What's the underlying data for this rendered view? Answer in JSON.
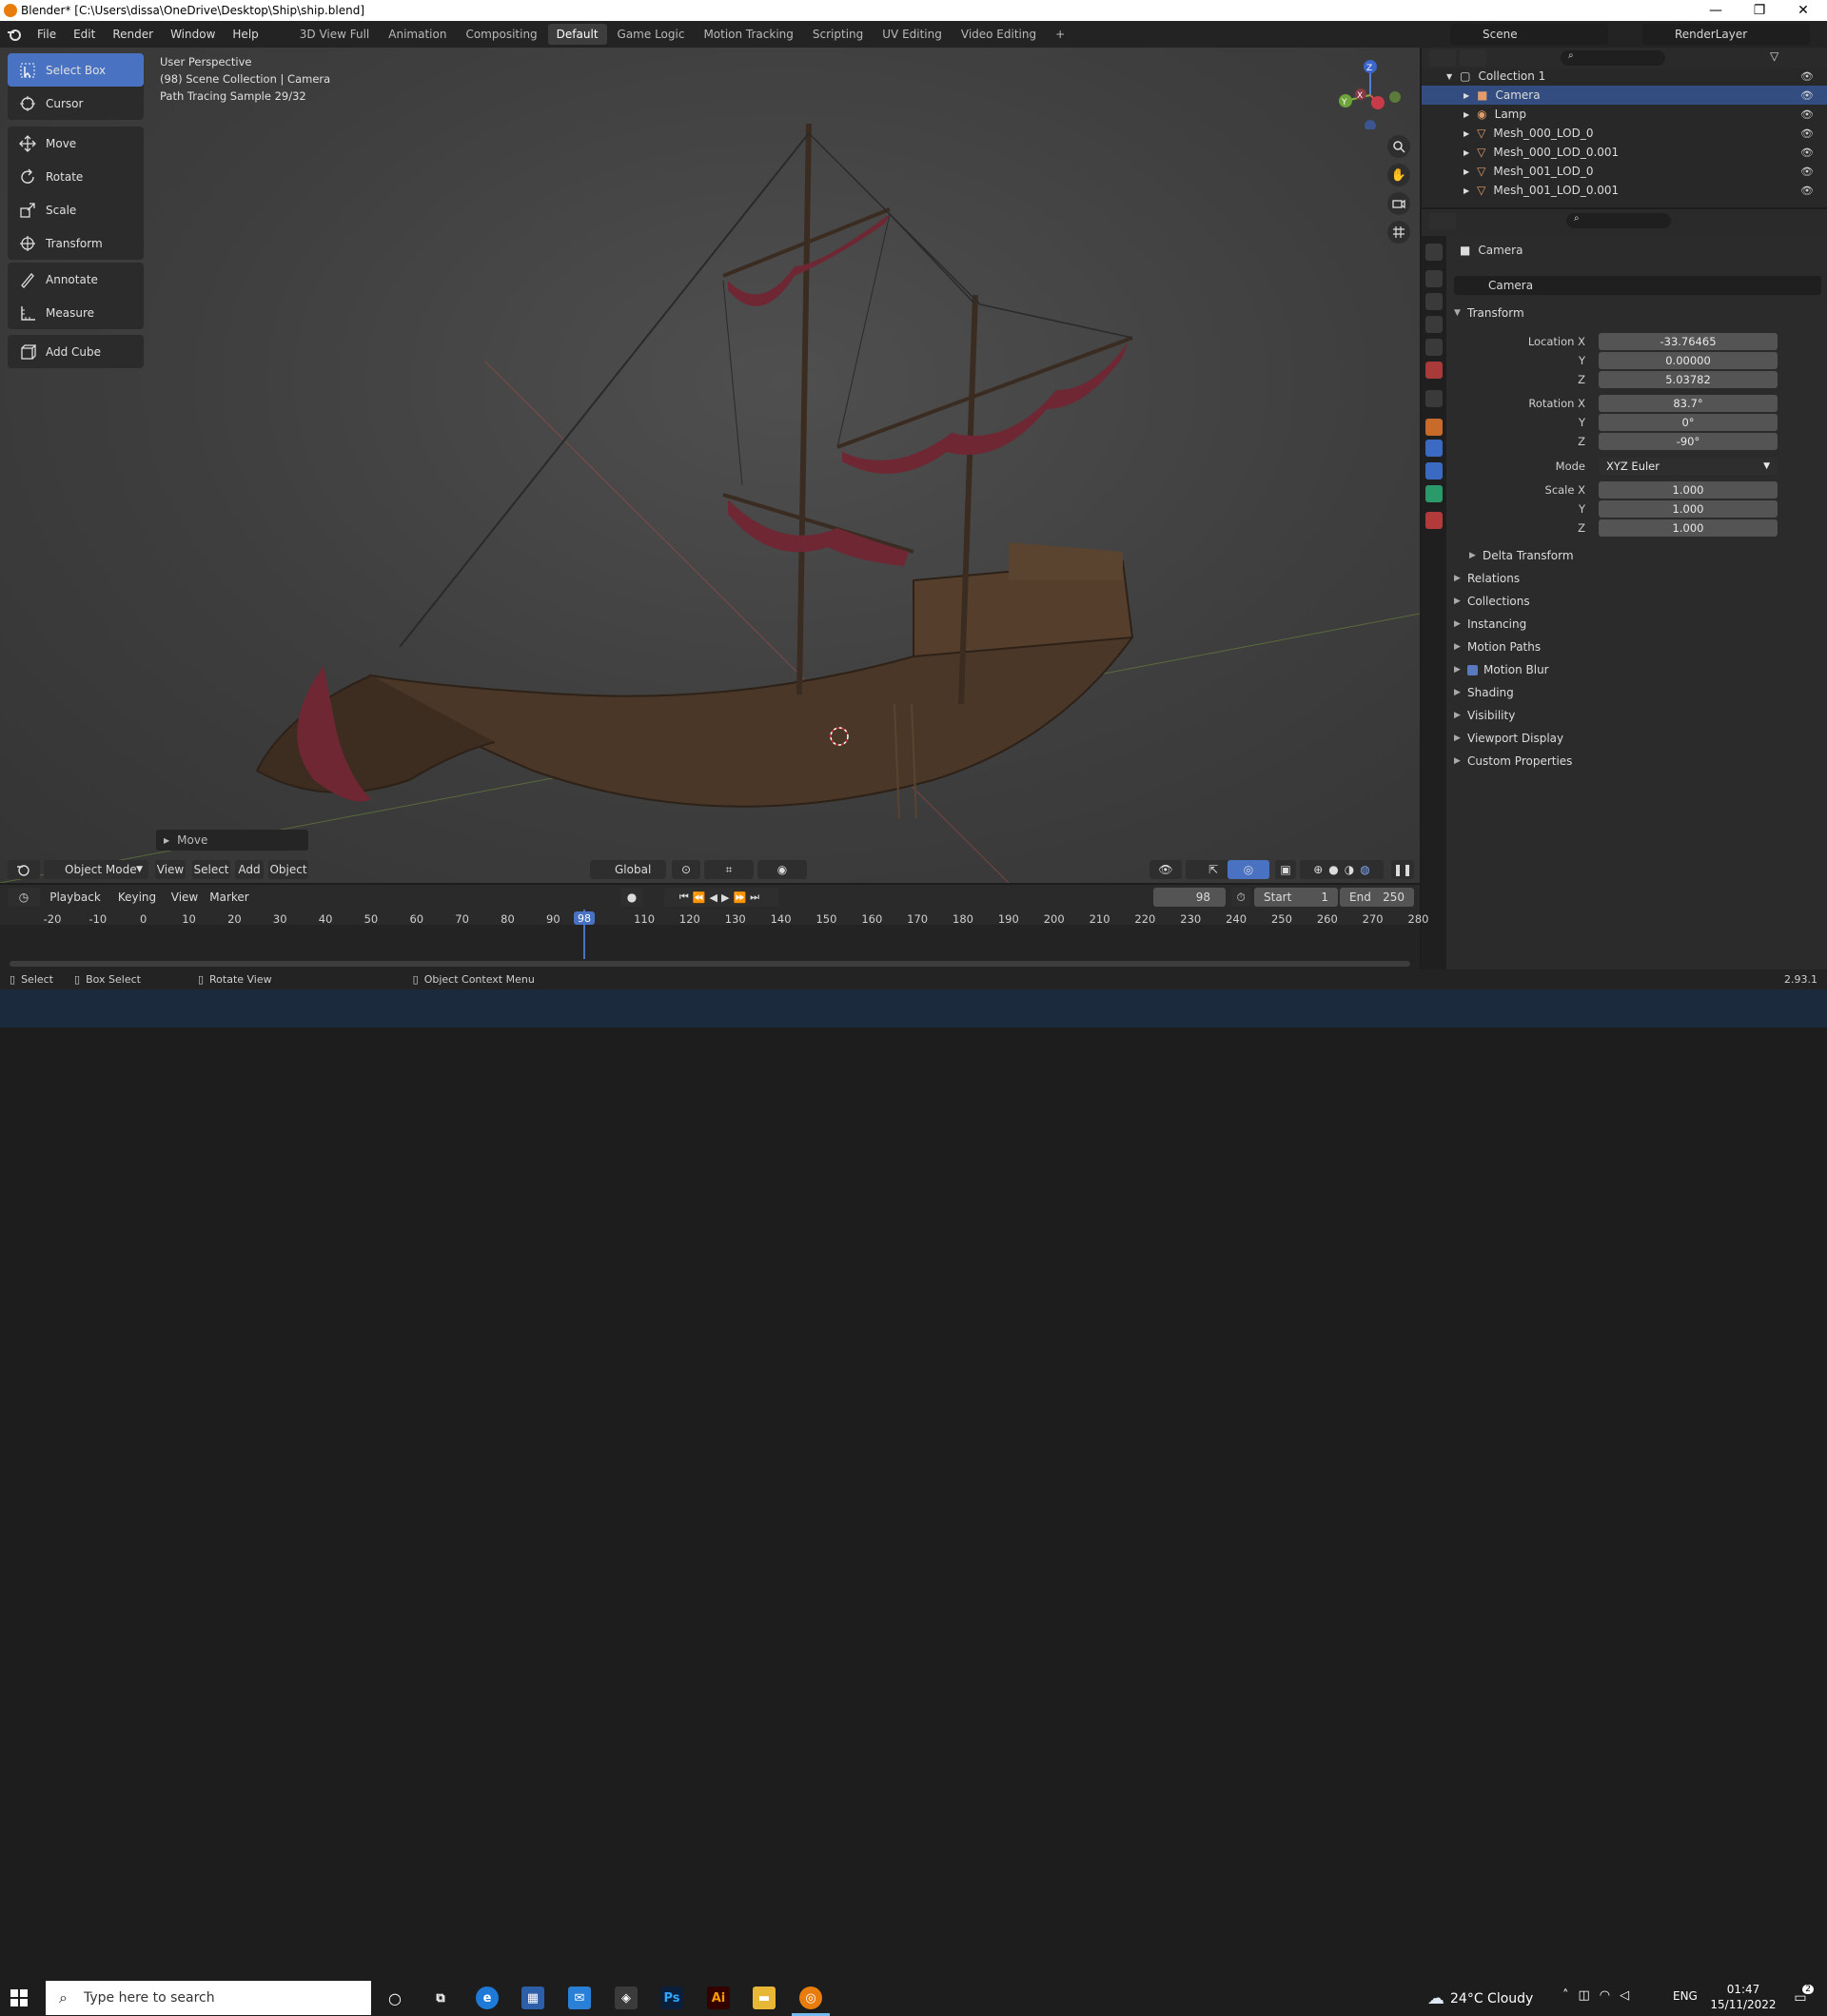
{
  "titlebar": {
    "title": "Blender* [C:\\Users\\dissa\\OneDrive\\Desktop\\Ship\\ship.blend]",
    "minimize": "—",
    "maximize": "❐",
    "close": "✕"
  },
  "menubar": {
    "items": [
      "File",
      "Edit",
      "Render",
      "Window",
      "Help"
    ],
    "workspaces": [
      "3D View Full",
      "Animation",
      "Compositing",
      "Default",
      "Game Logic",
      "Motion Tracking",
      "Scripting",
      "UV Editing",
      "Video Editing"
    ],
    "active_workspace": "Default",
    "add_tab": "+",
    "scene_label": "Scene",
    "renderlayer_label": "RenderLayer"
  },
  "viewport": {
    "info_line1": "User Perspective",
    "info_line2": "(98) Scene Collection | Camera",
    "info_line3": "Path Tracing Sample 29/32",
    "last_op": "Move",
    "gizmo_x": "X",
    "gizmo_y": "Y",
    "gizmo_z": "Z"
  },
  "toolbar": {
    "tools": [
      {
        "label": "Select Box",
        "icon": "select-box-icon",
        "active": true
      },
      {
        "label": "Cursor",
        "icon": "cursor-icon"
      },
      {
        "label": "Move",
        "icon": "move-icon"
      },
      {
        "label": "Rotate",
        "icon": "rotate-icon"
      },
      {
        "label": "Scale",
        "icon": "scale-icon"
      },
      {
        "label": "Transform",
        "icon": "transform-icon"
      },
      {
        "label": "Annotate",
        "icon": "annotate-icon"
      },
      {
        "label": "Measure",
        "icon": "measure-icon"
      },
      {
        "label": "Add Cube",
        "icon": "add-cube-icon"
      }
    ]
  },
  "viewport_header": {
    "mode": "Object Mode",
    "view": "View",
    "select": "Select",
    "add": "Add",
    "object": "Object",
    "orientation": "Global"
  },
  "outliner": {
    "collection": "Collection 1",
    "items": [
      {
        "label": "Camera",
        "icon": "camera-icon",
        "selected": true
      },
      {
        "label": "Lamp",
        "icon": "lamp-icon"
      },
      {
        "label": "Mesh_000_LOD_0",
        "icon": "mesh-icon"
      },
      {
        "label": "Mesh_000_LOD_0.001",
        "icon": "mesh-icon"
      },
      {
        "label": "Mesh_001_LOD_0",
        "icon": "mesh-icon"
      },
      {
        "label": "Mesh_001_LOD_0.001",
        "icon": "mesh-icon"
      }
    ]
  },
  "properties": {
    "breadcrumb": "Camera",
    "object_name": "Camera",
    "transform_label": "Transform",
    "location": {
      "label": "Location X",
      "x": "-33.76465",
      "y": "0.00000",
      "z": "5.03782"
    },
    "rotation": {
      "label": "Rotation X",
      "x": "83.7°",
      "y": "0°",
      "z": "-90°"
    },
    "mode_label": "Mode",
    "mode_value": "XYZ Euler",
    "scale": {
      "label": "Scale X",
      "x": "1.000",
      "y": "1.000",
      "z": "1.000"
    },
    "axis_y": "Y",
    "axis_z": "Z",
    "delta_transform": "Delta Transform",
    "panels": [
      "Relations",
      "Collections",
      "Instancing",
      "Motion Paths",
      "Motion Blur",
      "Shading",
      "Visibility",
      "Viewport Display",
      "Custom Properties"
    ]
  },
  "timeline": {
    "playback": "Playback",
    "keying": "Keying",
    "view": "View",
    "marker": "Marker",
    "current_frame": "98",
    "start_label": "Start",
    "start_value": "1",
    "end_label": "End",
    "end_value": "250",
    "ticks": [
      "-20",
      "-10",
      "0",
      "10",
      "20",
      "30",
      "40",
      "50",
      "60",
      "70",
      "80",
      "90",
      "98",
      "110",
      "120",
      "130",
      "140",
      "150",
      "160",
      "170",
      "180",
      "190",
      "200",
      "210",
      "220",
      "230",
      "240",
      "250",
      "260",
      "270",
      "280"
    ]
  },
  "statusbar": {
    "select": "Select",
    "box_select": "Box Select",
    "rotate_view": "Rotate View",
    "context_menu": "Object Context Menu",
    "version": "2.93.1"
  },
  "taskbar": {
    "search_placeholder": "Type here to search",
    "weather": "24°C  Cloudy",
    "language": "ENG",
    "time": "01:47",
    "date": "15/11/2022",
    "notif_count": "2"
  }
}
